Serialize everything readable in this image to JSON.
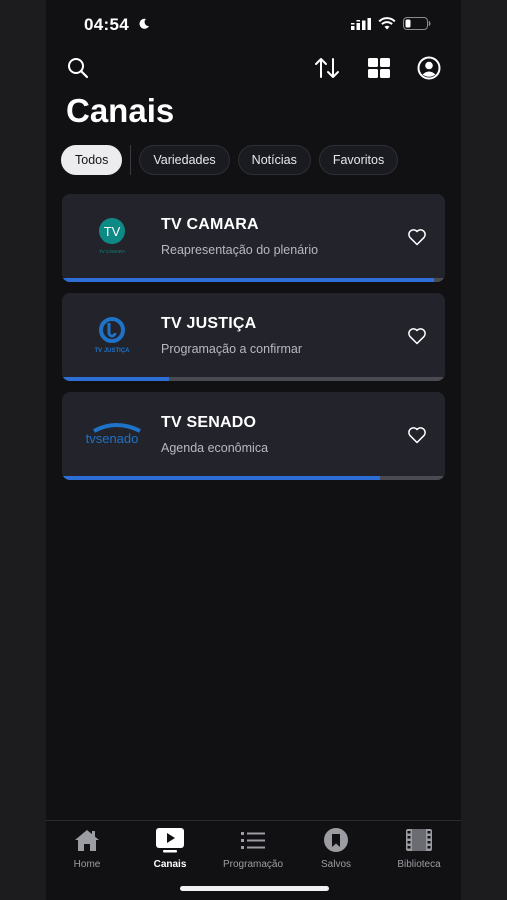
{
  "status_bar": {
    "time": "04:54"
  },
  "header": {
    "title": "Canais",
    "icons": [
      "search-icon",
      "sort-icon",
      "grid-icon",
      "account-icon"
    ]
  },
  "filters": [
    {
      "label": "Todos",
      "active": true
    },
    {
      "label": "Variedades",
      "active": false
    },
    {
      "label": "Notícias",
      "active": false
    },
    {
      "label": "Favoritos",
      "active": false
    }
  ],
  "channels": [
    {
      "name": "TV CAMARA",
      "program": "Reapresentação do plenário",
      "logo_text": "TV CÂMARA",
      "progress": 0.97
    },
    {
      "name": "TV JUSTIÇA",
      "program": "Programação a confirmar",
      "logo_text": "TV JUSTIÇA",
      "progress": 0.28
    },
    {
      "name": "TV SENADO",
      "program": "Agenda econômica",
      "logo_text": "tvsenado",
      "progress": 0.83
    }
  ],
  "bottom_nav": [
    {
      "label": "Home",
      "icon": "home-icon",
      "active": false
    },
    {
      "label": "Canais",
      "icon": "tv-play-icon",
      "active": true
    },
    {
      "label": "Programação",
      "icon": "list-icon",
      "active": false
    },
    {
      "label": "Salvos",
      "icon": "bookmark-icon",
      "active": false
    },
    {
      "label": "Biblioteca",
      "icon": "film-icon",
      "active": false
    }
  ],
  "colors": {
    "accent": "#2d6fd6",
    "background": "#111114",
    "card": "#23242b"
  }
}
